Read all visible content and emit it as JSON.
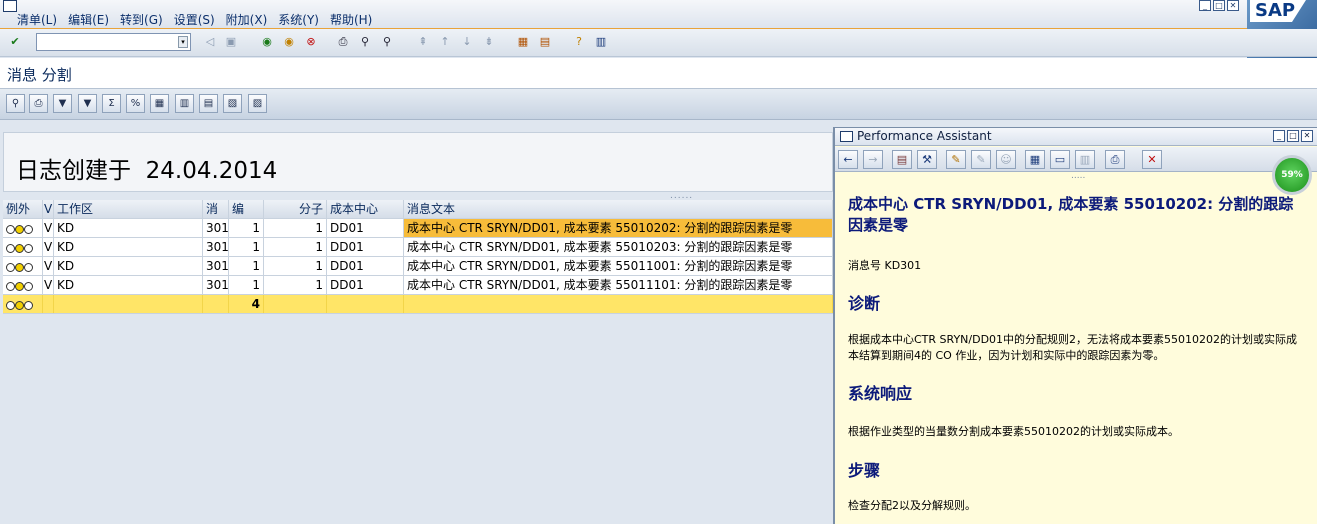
{
  "menu": {
    "items": [
      "清单(L)",
      "编辑(E)",
      "转到(G)",
      "设置(S)",
      "附加(X)",
      "系统(Y)",
      "帮助(H)"
    ],
    "logo": "SAP"
  },
  "toolbar": {
    "command_value": ""
  },
  "screen": {
    "title": "消息 分割"
  },
  "header": {
    "label": "日志创建于",
    "date": "24.04.2014"
  },
  "table": {
    "columns": [
      "例外",
      "V",
      "工作区",
      "消",
      "编",
      "分子",
      "成本中心",
      "消息文本"
    ],
    "rows": [
      {
        "v": "V",
        "area": "KD",
        "msg": "301",
        "num": "1",
        "numerator": "1",
        "cc": "DD01",
        "text": "成本中心 CTR SRYN/DD01, 成本要素 55010202: 分割的跟踪因素是零"
      },
      {
        "v": "V",
        "area": "KD",
        "msg": "301",
        "num": "1",
        "numerator": "1",
        "cc": "DD01",
        "text": "成本中心 CTR SRYN/DD01, 成本要素 55010203: 分割的跟踪因素是零"
      },
      {
        "v": "V",
        "area": "KD",
        "msg": "301",
        "num": "1",
        "numerator": "1",
        "cc": "DD01",
        "text": "成本中心 CTR SRYN/DD01, 成本要素 55011001: 分割的跟踪因素是零"
      },
      {
        "v": "V",
        "area": "KD",
        "msg": "301",
        "num": "1",
        "numerator": "1",
        "cc": "DD01",
        "text": "成本中心 CTR SRYN/DD01, 成本要素 55011101: 分割的跟踪因素是零"
      }
    ],
    "total": "4"
  },
  "assistant": {
    "title": "Performance Assistant",
    "heading": "成本中心  CTR SRYN/DD01, 成本要素  55010202: 分割的跟踪因素是零",
    "msg_number": "消息号  KD301",
    "s1_title": "诊断",
    "s1_text": "根据成本中心CTR SRYN/DD01中的分配规则2，无法将成本要素55010202的计划或实际成本结算到期间4的  CO 作业，因为计划和实际中的跟踪因素为零。",
    "s2_title": "系统响应",
    "s2_text": "根据作业类型的当量数分割成本要素55010202的计划或实际成本。",
    "s3_title": "步骤",
    "s3_text": "检查分配2以及分解规则。"
  },
  "gauge": {
    "label": "59%"
  },
  "colors": {
    "selected": "#f7bc3a",
    "total_row": "#ffe567",
    "assistant_bg": "#fffcdc"
  }
}
